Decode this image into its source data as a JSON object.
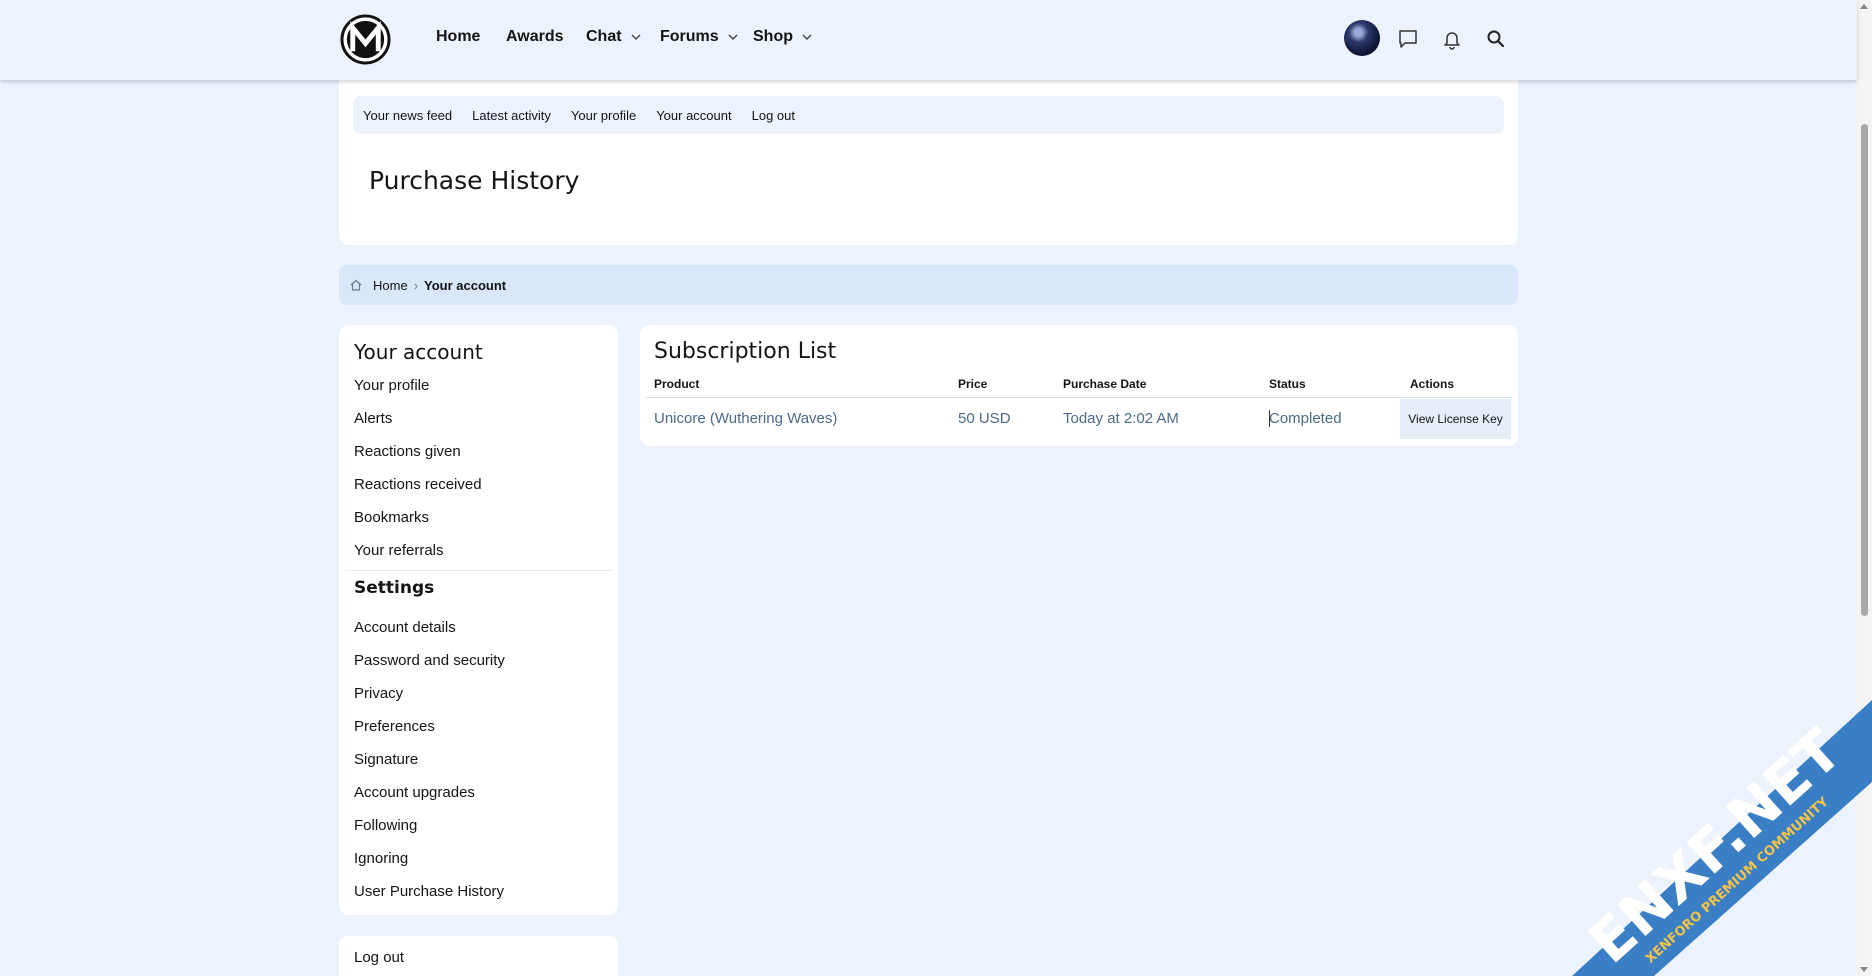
{
  "nav": {
    "items": [
      {
        "label": "Home",
        "has_dropdown": false
      },
      {
        "label": "Awards",
        "has_dropdown": false
      },
      {
        "label": "Chat",
        "has_dropdown": true
      },
      {
        "label": "Forums",
        "has_dropdown": true
      },
      {
        "label": "Shop",
        "has_dropdown": true
      }
    ],
    "icons": [
      "messages-icon",
      "bell-icon",
      "search-icon"
    ]
  },
  "subnav": {
    "items": [
      "Your news feed",
      "Latest activity",
      "Your profile",
      "Your account",
      "Log out"
    ]
  },
  "page_title": "Purchase History",
  "breadcrumb": {
    "home": "Home",
    "current": "Your account"
  },
  "sidebar": {
    "heading": "Your account",
    "account_items": [
      "Your profile",
      "Alerts",
      "Reactions given",
      "Reactions received",
      "Bookmarks",
      "Your referrals"
    ],
    "settings_heading": "Settings",
    "settings_items": [
      "Account details",
      "Password and security",
      "Privacy",
      "Preferences",
      "Signature",
      "Account upgrades",
      "Following",
      "Ignoring",
      "User Purchase History"
    ],
    "logout": "Log out"
  },
  "main": {
    "title": "Subscription List",
    "columns": [
      "Product",
      "Price",
      "Purchase Date",
      "Status",
      "Actions"
    ],
    "rows": [
      {
        "product": "Unicore (Wuthering Waves)",
        "price": "50 USD",
        "date": "Today at 2:02 AM",
        "status": "Completed",
        "action": "View License Key"
      }
    ]
  },
  "watermark": {
    "brand": "ENXF.NET",
    "tagline": "XENFORO PREMIUM COMMUNITY"
  },
  "colors": {
    "page_bg": "#ecf3fd",
    "card_bg": "#ffffff",
    "breadcrumb_bg": "#d9e7fa",
    "link_text": "#4a6a8a",
    "watermark_blue": "#3a7fc6",
    "watermark_yellow": "#f6c445"
  }
}
